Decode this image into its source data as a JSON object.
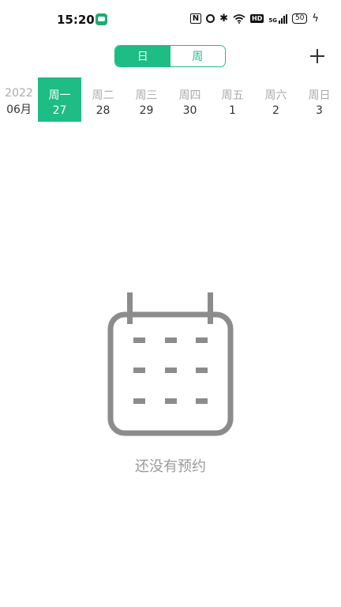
{
  "status_bar": {
    "time": "15:20",
    "nfc": "N",
    "hd": "HD",
    "network": "5G",
    "battery": "50"
  },
  "view_toggle": {
    "day_label": "日",
    "week_label": "周",
    "selected": "day"
  },
  "calendar": {
    "year": "2022",
    "month": "06月",
    "days": [
      {
        "name": "周一",
        "date": "27",
        "selected": true
      },
      {
        "name": "周二",
        "date": "28",
        "selected": false
      },
      {
        "name": "周三",
        "date": "29",
        "selected": false
      },
      {
        "name": "周四",
        "date": "30",
        "selected": false
      },
      {
        "name": "周五",
        "date": "1",
        "selected": false
      },
      {
        "name": "周六",
        "date": "2",
        "selected": false
      },
      {
        "name": "周日",
        "date": "3",
        "selected": false
      }
    ]
  },
  "empty_state": {
    "icon": "calendar-icon",
    "message": "还没有预约"
  },
  "colors": {
    "accent": "#1dbd85",
    "muted": "#9a9a9a"
  }
}
